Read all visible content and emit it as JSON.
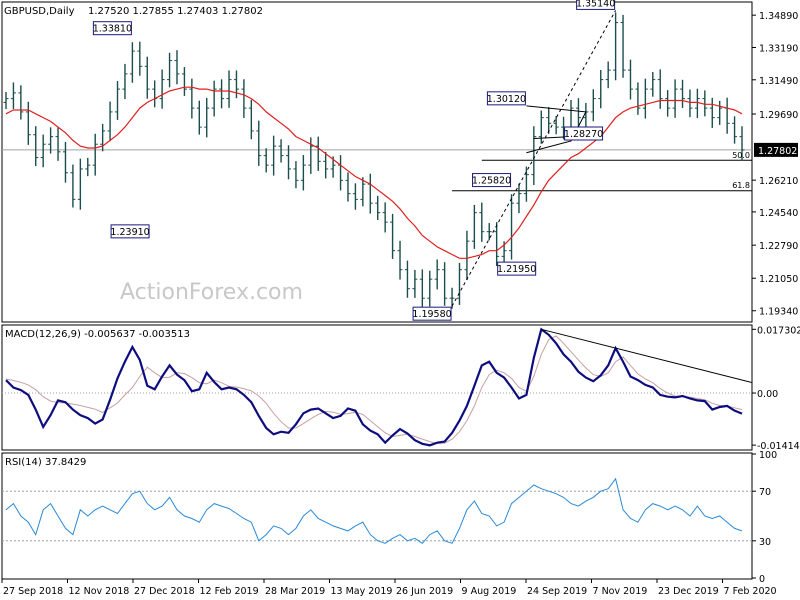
{
  "header": {
    "symbol": "GBPUSD,Daily",
    "ohlc": "1.27520 1.27855 1.27403 1.27802"
  },
  "colors": {
    "background": "#ffffff",
    "bar": "#1a4d4d",
    "ma": "#e0201e",
    "macd": "#0d0d80",
    "signal": "#c8a0a0",
    "rsi": "#2a8ad8",
    "line": "#000000",
    "grid_ref": "#a0a0a0",
    "label_box": "#1a1a80",
    "price_tag_bg": "#000000",
    "price_tag_text": "#ffffff",
    "watermark": "#c8c8c8"
  },
  "watermark": "ActionForex.com",
  "chart_data": [
    {
      "type": "line",
      "panel": "price",
      "title": "GBPUSD,Daily",
      "ylim": [
        1.188,
        1.3553
      ],
      "y_ticks": [
        "1.34890",
        "1.33190",
        "1.31490",
        "1.29690",
        "1.27802",
        "1.26210",
        "1.24540",
        "1.22790",
        "1.21050",
        "1.19340"
      ],
      "current_price": "1.27802",
      "x_dates": [
        "27 Sep 2018",
        "12 Nov 2018",
        "27 Dec 2018",
        "12 Feb 2019",
        "28 Mar 2019",
        "13 May 2019",
        "26 Jun 2019",
        "9 Aug 2019",
        "24 Sep 2019",
        "7 Nov 2019",
        "23 Dec 2019",
        "7 Feb 2020"
      ],
      "series": [
        {
          "kind": "ohlc",
          "close": [
            1.305,
            1.308,
            1.298,
            1.286,
            1.274,
            1.281,
            1.285,
            1.277,
            1.266,
            1.252,
            1.268,
            1.27,
            1.281,
            1.288,
            1.298,
            1.31,
            1.318,
            1.33,
            1.322,
            1.31,
            1.305,
            1.315,
            1.325,
            1.318,
            1.31,
            1.3,
            1.29,
            1.3,
            1.31,
            1.305,
            1.315,
            1.31,
            1.3,
            1.288,
            1.275,
            1.27,
            1.28,
            1.275,
            1.268,
            1.262,
            1.27,
            1.28,
            1.272,
            1.268,
            1.27,
            1.262,
            1.255,
            1.252,
            1.26,
            1.25,
            1.245,
            1.24,
            1.225,
            1.215,
            1.205,
            1.21,
            1.2,
            1.21,
            1.215,
            1.2,
            1.2,
            1.215,
            1.23,
            1.245,
            1.235,
            1.235,
            1.222,
            1.225,
            1.25,
            1.255,
            1.265,
            1.285,
            1.295,
            1.292,
            1.29,
            1.289,
            1.3,
            1.295,
            1.298,
            1.305,
            1.315,
            1.32,
            1.345,
            1.32,
            1.31,
            1.3,
            1.31,
            1.315,
            1.305,
            1.3,
            1.31,
            1.305,
            1.3,
            1.305,
            1.3,
            1.295,
            1.3,
            1.292,
            1.285,
            1.278
          ],
          "name": ""
        },
        {
          "kind": "moving-average",
          "values": [
            1.297,
            1.299,
            1.299,
            1.299,
            1.297,
            1.295,
            1.293,
            1.29,
            1.287,
            1.283,
            1.28,
            1.279,
            1.279,
            1.28,
            1.283,
            1.286,
            1.29,
            1.295,
            1.3,
            1.303,
            1.305,
            1.307,
            1.309,
            1.31,
            1.311,
            1.311,
            1.31,
            1.31,
            1.309,
            1.309,
            1.309,
            1.308,
            1.307,
            1.305,
            1.302,
            1.298,
            1.295,
            1.292,
            1.289,
            1.285,
            1.283,
            1.281,
            1.279,
            1.276,
            1.273,
            1.27,
            1.267,
            1.264,
            1.262,
            1.26,
            1.257,
            1.254,
            1.251,
            1.247,
            1.242,
            1.238,
            1.233,
            1.23,
            1.227,
            1.225,
            1.223,
            1.221,
            1.221,
            1.222,
            1.223,
            1.225,
            1.225,
            1.228,
            1.232,
            1.237,
            1.243,
            1.249,
            1.256,
            1.262,
            1.266,
            1.27,
            1.274,
            1.276,
            1.279,
            1.282,
            1.285,
            1.29,
            1.295,
            1.298,
            1.3,
            1.301,
            1.302,
            1.303,
            1.304,
            1.304,
            1.304,
            1.304,
            1.303,
            1.303,
            1.302,
            1.302,
            1.301,
            1.3,
            1.299,
            1.297
          ],
          "name": ""
        }
      ],
      "price_labels": [
        {
          "text": "1.35140",
          "index": 82,
          "price": 1.3514,
          "side": "left",
          "pos": "above"
        },
        {
          "text": "1.33810",
          "index": 17,
          "price": 1.3381,
          "side": "left",
          "pos": "above"
        },
        {
          "text": "1.23910",
          "index": 14,
          "price": 1.2391,
          "side": "right",
          "pos": "below"
        },
        {
          "text": "1.30120",
          "index": 70,
          "price": 1.3012,
          "side": "left",
          "pos": "above"
        },
        {
          "text": "1.28270",
          "index": 75,
          "price": 1.2827,
          "side": "right",
          "pos": "above"
        },
        {
          "text": "1.25820",
          "index": 68,
          "price": 1.2582,
          "side": "left",
          "pos": "above"
        },
        {
          "text": "1.21950",
          "index": 66,
          "price": 1.2195,
          "side": "right",
          "pos": "below"
        },
        {
          "text": "1.19580",
          "index": 60,
          "price": 1.1958,
          "side": "left",
          "pos": "below"
        }
      ],
      "fib_labels": [
        "50.0",
        "61.8"
      ]
    },
    {
      "type": "line",
      "panel": "macd",
      "title": "MACD(12,26,9) -0.005637 -0.003513",
      "ylim": [
        -0.0152,
        0.0182
      ],
      "y_ticks": [
        "0.017302",
        "0.00",
        "-0.014148"
      ],
      "series": [
        {
          "name": "",
          "values": [
            0.0035,
            0.0015,
            0.0008,
            -0.0005,
            -0.0045,
            -0.0092,
            -0.006,
            -0.002,
            -0.0025,
            -0.0045,
            -0.006,
            -0.0068,
            -0.0083,
            -0.0072,
            -0.0018,
            0.004,
            0.0085,
            0.0125,
            0.009,
            0.002,
            0.001,
            0.0045,
            0.0075,
            0.005,
            0.0035,
            0.0005,
            0.001,
            0.0055,
            0.003,
            0.001,
            0.0015,
            0.001,
            -0.0005,
            -0.0025,
            -0.0062,
            -0.0095,
            -0.0112,
            -0.0105,
            -0.0108,
            -0.0085,
            -0.0055,
            -0.0045,
            -0.0042,
            -0.0055,
            -0.0068,
            -0.0062,
            -0.0042,
            -0.0048,
            -0.0085,
            -0.0102,
            -0.0112,
            -0.0135,
            -0.0115,
            -0.0098,
            -0.011,
            -0.0128,
            -0.0138,
            -0.0142,
            -0.0135,
            -0.0132,
            -0.0108,
            -0.0075,
            -0.0035,
            0.002,
            0.0075,
            0.0085,
            0.0055,
            0.0042,
            0.0015,
            -0.0015,
            -0.0005,
            0.0095,
            0.0173,
            0.0158,
            0.0135,
            0.0105,
            0.0085,
            0.0058,
            0.0042,
            0.0032,
            0.0048,
            0.0075,
            0.0122,
            0.0085,
            0.0045,
            0.0035,
            0.0022,
            0.0015,
            -0.0005,
            -0.001,
            -0.0012,
            -0.0008,
            -0.0015,
            -0.002,
            -0.0022,
            -0.0045,
            -0.0038,
            -0.0035,
            -0.0048,
            -0.0056
          ]
        },
        {
          "name": "",
          "values": [
            0.0038,
            0.0034,
            0.0029,
            0.0022,
            0.0009,
            -0.001,
            -0.0022,
            -0.0026,
            -0.0027,
            -0.003,
            -0.0034,
            -0.0039,
            -0.0044,
            -0.0053,
            -0.004,
            -0.0027,
            -0.0005,
            0.0015,
            0.0045,
            0.007,
            0.0055,
            0.0042,
            0.0043,
            0.0055,
            0.0053,
            0.0042,
            0.0028,
            0.0025,
            0.0035,
            0.0028,
            0.0018,
            0.0016,
            0.0012,
            0.0006,
            -0.0008,
            -0.0028,
            -0.0055,
            -0.0078,
            -0.0095,
            -0.0095,
            -0.0083,
            -0.007,
            -0.0058,
            -0.005,
            -0.0052,
            -0.0058,
            -0.0056,
            -0.0052,
            -0.0058,
            -0.0075,
            -0.0092,
            -0.0108,
            -0.0118,
            -0.0115,
            -0.0112,
            -0.0118,
            -0.0125,
            -0.0132,
            -0.0137,
            -0.0136,
            -0.0125,
            -0.0105,
            -0.0075,
            -0.0035,
            0.0015,
            0.005,
            0.0062,
            0.0055,
            0.004,
            0.0015,
            0.0005,
            0.0045,
            0.0105,
            0.0145,
            0.0155,
            0.0135,
            0.0112,
            0.009,
            0.0068,
            0.005,
            0.0045,
            0.0055,
            0.0085,
            0.0098,
            0.0075,
            0.0052,
            0.0038,
            0.0028,
            0.0012,
            0.0,
            -0.0008,
            -0.0009,
            -0.0011,
            -0.0015,
            -0.0018,
            -0.0028,
            -0.0034,
            -0.0035,
            -0.004,
            -0.0045
          ]
        }
      ],
      "trendline": [
        [
          72,
          0.0173
        ],
        [
          82,
          0.0122
        ],
        [
          99,
          0.0063
        ]
      ]
    },
    {
      "type": "line",
      "panel": "rsi",
      "title": "RSI(14) 37.8429",
      "ylim": [
        0,
        100
      ],
      "y_ticks": [
        "100",
        "70",
        "30",
        "0"
      ],
      "levels": [
        70,
        30
      ],
      "series": [
        {
          "name": "",
          "values": [
            55,
            60,
            50,
            45,
            35,
            55,
            60,
            50,
            40,
            35,
            55,
            50,
            55,
            58,
            55,
            52,
            60,
            68,
            70,
            60,
            55,
            58,
            65,
            55,
            50,
            48,
            45,
            55,
            60,
            58,
            56,
            52,
            48,
            45,
            30,
            35,
            42,
            40,
            35,
            40,
            50,
            55,
            48,
            45,
            42,
            40,
            38,
            42,
            45,
            35,
            30,
            28,
            32,
            35,
            30,
            32,
            28,
            35,
            38,
            30,
            28,
            40,
            55,
            62,
            52,
            50,
            42,
            45,
            60,
            65,
            70,
            75,
            72,
            70,
            68,
            65,
            60,
            58,
            62,
            65,
            70,
            72,
            80,
            55,
            48,
            45,
            55,
            60,
            58,
            55,
            58,
            55,
            50,
            58,
            50,
            48,
            50,
            45,
            40,
            38
          ]
        }
      ]
    }
  ]
}
